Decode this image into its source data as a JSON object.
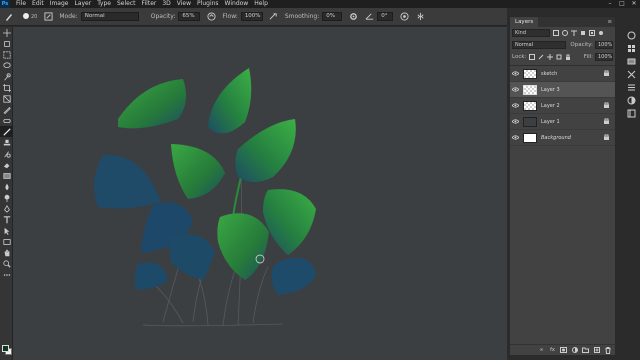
{
  "menubar": {
    "logo": "Ps",
    "items": [
      "File",
      "Edit",
      "Image",
      "Layer",
      "Type",
      "Select",
      "Filter",
      "3D",
      "View",
      "Plugins",
      "Window",
      "Help"
    ]
  },
  "options": {
    "brush_size": "20",
    "mode_label": "Mode:",
    "mode_value": "Normal",
    "opacity_label": "Opacity:",
    "opacity_value": "65%",
    "flow_label": "Flow:",
    "flow_value": "100%",
    "smoothing_label": "Smoothing:",
    "smoothing_value": "0%",
    "angle_value": "0°"
  },
  "layers_panel": {
    "tab": "Layers",
    "filter_kind": "Kind",
    "blend_mode": "Normal",
    "opacity_label": "Opacity:",
    "opacity_value": "100%",
    "lock_label": "Lock:",
    "fill_label": "Fill:",
    "fill_value": "100%",
    "layers": [
      {
        "name": "sketch",
        "thumb": "checker",
        "locked": true,
        "selected": false
      },
      {
        "name": "Layer 3",
        "thumb": "checker",
        "locked": false,
        "selected": true
      },
      {
        "name": "Layer 2",
        "thumb": "checker",
        "locked": true,
        "selected": false
      },
      {
        "name": "Layer 1",
        "thumb": "dark",
        "locked": true,
        "selected": false
      },
      {
        "name": "Background",
        "thumb": "white",
        "locked": true,
        "selected": false
      }
    ]
  },
  "colors": {
    "foreground": "#0b3a22",
    "background": "#f2f2f2",
    "canvas": "#3c3f42",
    "leaf_blue": "#1e4a68",
    "leaf_green": "#2e8a3a"
  }
}
